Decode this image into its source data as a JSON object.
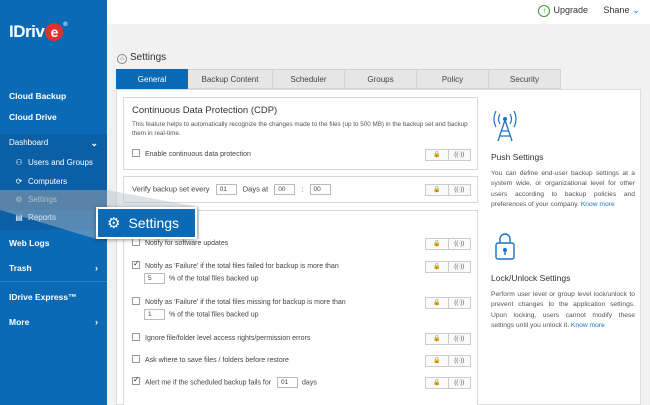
{
  "brand": {
    "logo_text": "IDriv",
    "logo_e": "e",
    "logo_mark": "®"
  },
  "topbar": {
    "upgrade_label": "Upgrade",
    "user_name": "Shane"
  },
  "sidebar": {
    "cloud_backup": "Cloud Backup",
    "cloud_drive": "Cloud Drive",
    "dashboard": "Dashboard",
    "dashboard_items": [
      {
        "label": "Users and Groups",
        "icon": "users-icon"
      },
      {
        "label": "Computers",
        "icon": "computer-icon"
      },
      {
        "label": "Settings",
        "icon": "gear-icon"
      },
      {
        "label": "Reports",
        "icon": "report-icon"
      }
    ],
    "web_logs": "Web Logs",
    "trash": "Trash",
    "express": "IDrive Express™",
    "more": "More"
  },
  "page": {
    "title": "Settings"
  },
  "tabs": [
    "General",
    "Backup Content",
    "Scheduler",
    "Groups",
    "Policy",
    "Security"
  ],
  "cdp": {
    "title": "Continuous Data Protection (CDP)",
    "description": "This feature helps to automatically recognize the changes made to the files (up to 500 MB) in the backup set and backup them in real-time.",
    "enable_label": "Enable continuous data protection"
  },
  "verify": {
    "label": "Verify backup set every",
    "days_value": "01",
    "days_at": "Days at",
    "hour": "00",
    "minute": "00"
  },
  "options": {
    "notify_updates": "Notify for software updates",
    "failed_label": "Notify as 'Failure' if the total files failed for backup is more than",
    "failed_value": "5",
    "failed_suffix": "% of the total files backed up",
    "missing_label": "Notify as 'Failure' if the total files missing for backup is more than",
    "missing_value": "1",
    "missing_suffix": "% of the total files backed up",
    "ignore_errors": "Ignore file/folder level access rights/permission errors",
    "ask_where": "Ask where to save files / folders before restore",
    "alert_label": "Alert me if the scheduled backup fails for",
    "alert_value": "01",
    "alert_suffix": "days"
  },
  "info": {
    "push_title": "Push Settings",
    "push_text": "You can define end-user backup settings at a system wide, or organizational level for other users according to backup policies and preferences of your company.",
    "lock_title": "Lock/Unlock Settings",
    "lock_text": "Perform user level or group level lock/unlock to prevent changes to the application settings. Upon locking, users cannot modify these settings until you unlock it.",
    "know_more": "Know more"
  },
  "callout": {
    "label": "Settings"
  },
  "colors": {
    "brand_blue": "#0a6ab6",
    "logo_red": "#e0312b",
    "link": "#1a73c9"
  }
}
